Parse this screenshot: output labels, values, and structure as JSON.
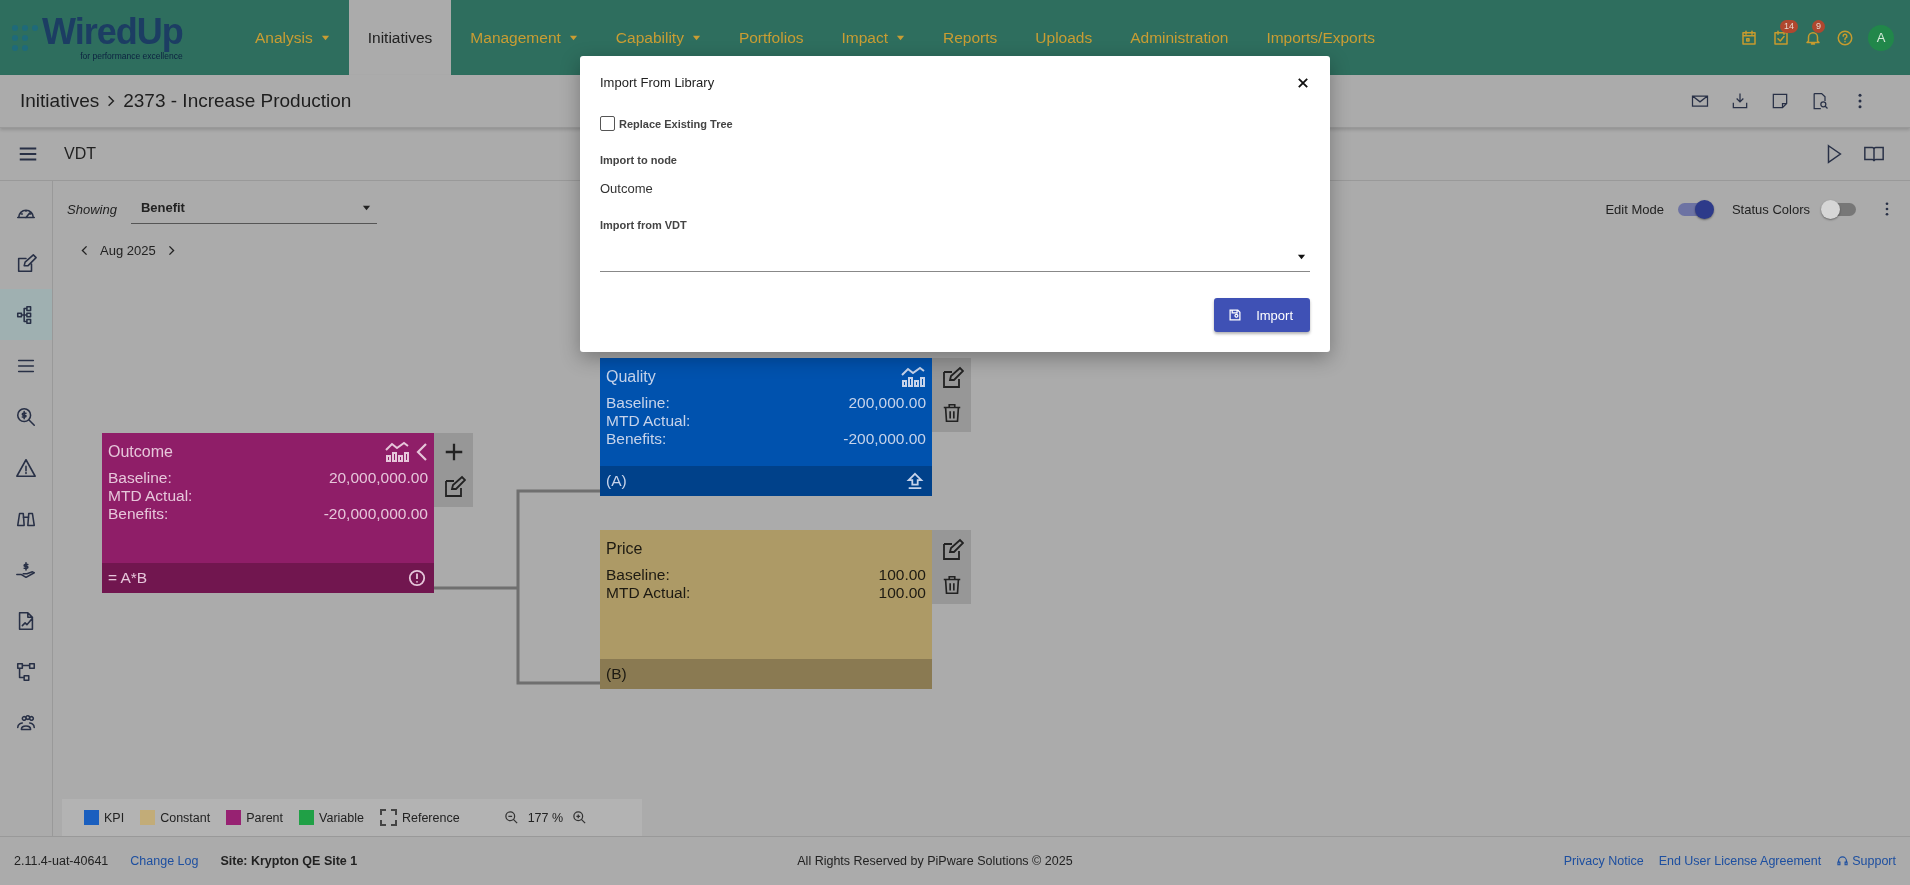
{
  "nav": {
    "logo": {
      "name": "WiredUp",
      "tagline": "for performance excellence"
    },
    "items": [
      {
        "label": "Analysis",
        "has_menu": true,
        "selected": false
      },
      {
        "label": "Initiatives",
        "has_menu": false,
        "selected": true
      },
      {
        "label": "Management",
        "has_menu": true,
        "selected": false
      },
      {
        "label": "Capability",
        "has_menu": true,
        "selected": false
      },
      {
        "label": "Portfolios",
        "has_menu": false,
        "selected": false
      },
      {
        "label": "Impact",
        "has_menu": true,
        "selected": false
      },
      {
        "label": "Reports",
        "has_menu": false,
        "selected": false
      },
      {
        "label": "Uploads",
        "has_menu": false,
        "selected": false
      },
      {
        "label": "Administration",
        "has_menu": false,
        "selected": false
      },
      {
        "label": "Imports/Exports",
        "has_menu": false,
        "selected": false
      }
    ],
    "actions": [
      {
        "kind": "calendar"
      },
      {
        "kind": "tasks",
        "badge": "14"
      },
      {
        "kind": "bell",
        "badge": "9"
      },
      {
        "kind": "help"
      }
    ],
    "avatar": "A"
  },
  "breadcrumb": [
    "Initiatives",
    "2373 - Increase Production"
  ],
  "toolbar": {
    "title": "VDT"
  },
  "sidebar": {
    "items": [
      {
        "selected": false
      },
      {
        "selected": false
      },
      {
        "selected": true
      },
      {
        "selected": false
      },
      {
        "selected": false
      },
      {
        "selected": false
      },
      {
        "selected": false
      },
      {
        "selected": false
      },
      {
        "selected": false
      },
      {
        "selected": false
      },
      {
        "selected": false
      }
    ]
  },
  "showing": {
    "label": "Showing",
    "value": "Benefit"
  },
  "period": "Aug 2025",
  "switches": [
    {
      "label": "Edit Mode",
      "on": true
    },
    {
      "label": "Status Colors",
      "on": false
    }
  ],
  "nodes": [
    {
      "kind": "parent",
      "title": "Outcome",
      "rows": [
        {
          "label": "Baseline:",
          "value": "20,000,000.00"
        },
        {
          "label": "MTD Actual:"
        },
        {
          "label": "Benefits:",
          "value": "-20,000,000.00"
        }
      ],
      "footer": "= A*B"
    },
    {
      "kind": "kpi",
      "title": "Quality",
      "rows": [
        {
          "label": "Baseline:",
          "value": "200,000.00"
        },
        {
          "label": "MTD Actual:"
        },
        {
          "label": "Benefits:",
          "value": "-200,000.00"
        }
      ],
      "footer": "(A)"
    },
    {
      "kind": "constant",
      "title": "Price",
      "rows": [
        {
          "label": "Baseline:",
          "value": "100.00"
        },
        {
          "label": "MTD Actual:",
          "value": "100.00"
        }
      ],
      "footer": "(B)"
    }
  ],
  "legend": [
    {
      "label": "KPI",
      "color": "#1a5fbf"
    },
    {
      "label": "Constant",
      "color": "#c2ac78"
    },
    {
      "label": "Parent",
      "color": "#972272"
    },
    {
      "label": "Variable",
      "color": "#20a046"
    },
    {
      "label": "Reference",
      "kind": "dashed"
    }
  ],
  "zoom": "177 %",
  "footer": {
    "version": "2.11.4-uat-40641",
    "changelog": "Change Log",
    "site": "Site: Krypton QE Site 1",
    "copyright": "All Rights Reserved by PiPware Solutions © 2025",
    "links": [
      "Privacy Notice",
      "End User License Agreement",
      "Support"
    ]
  },
  "dialog": {
    "title": "Import From Library",
    "replace": {
      "label": "Replace Existing Tree",
      "checked": false
    },
    "target_label": "Import to node",
    "target_value": "Outcome",
    "source_label": "Import from VDT",
    "button": "Import"
  }
}
